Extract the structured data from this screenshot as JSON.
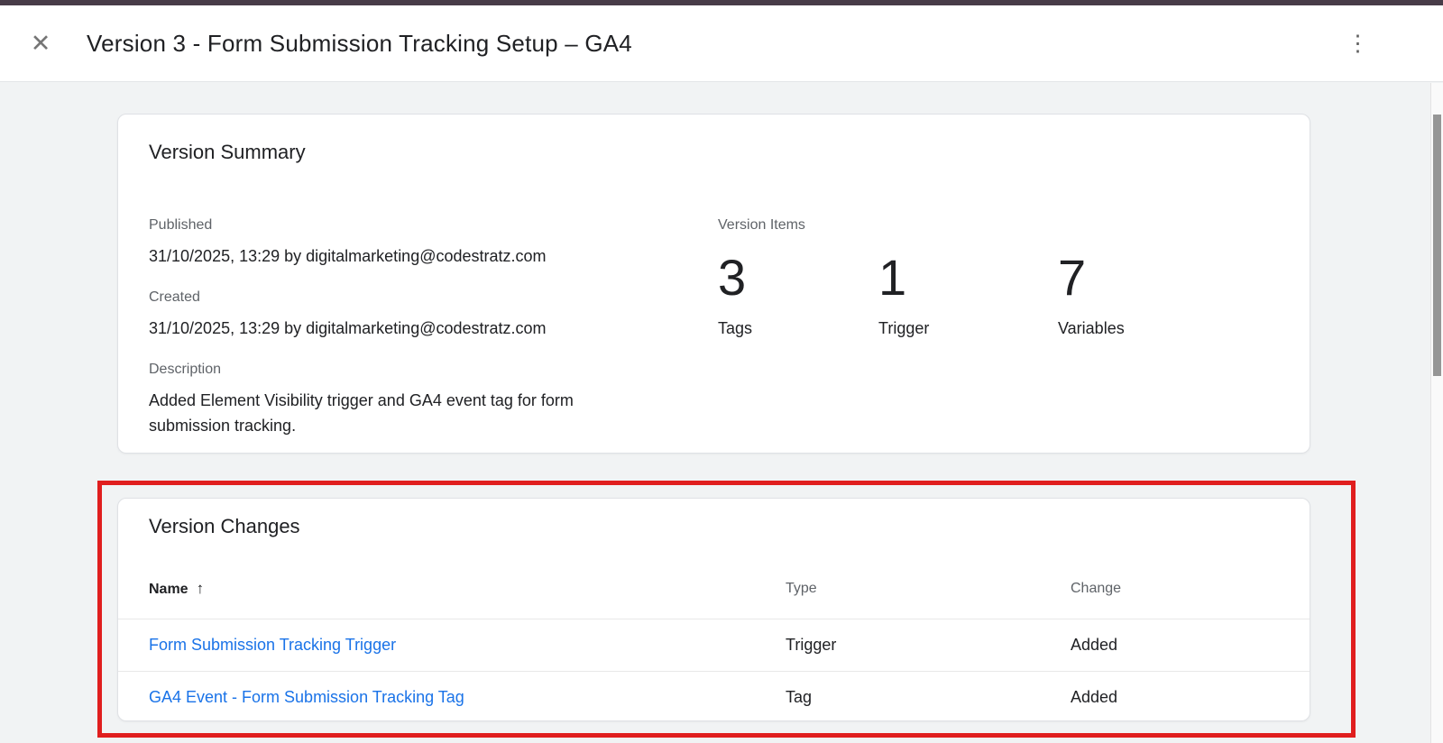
{
  "topbar": {
    "title": "Version 3 - Form Submission Tracking Setup – GA4",
    "close_glyph": "✕",
    "menu_glyph": "⋮"
  },
  "summary_card": {
    "title": "Version Summary",
    "fields": [
      {
        "label": "Published",
        "value": "31/10/2025, 13:29 by digitalmarketing@codestratz.com"
      },
      {
        "label": "Created",
        "value": "31/10/2025, 13:29 by digitalmarketing@codestratz.com"
      },
      {
        "label": "Description",
        "value": "Added Element Visibility trigger and GA4 event tag for form submission tracking."
      }
    ],
    "items": {
      "label": "Version Items",
      "stats": [
        {
          "count": "3",
          "label": "Tags"
        },
        {
          "count": "1",
          "label": "Trigger"
        },
        {
          "count": "7",
          "label": "Variables"
        }
      ]
    }
  },
  "changes_card": {
    "title": "Version Changes",
    "columns": {
      "name": "Name",
      "type": "Type",
      "change": "Change"
    },
    "sort_glyph": "↑",
    "rows": [
      {
        "name": "Form Submission Tracking Trigger",
        "type": "Trigger",
        "change": "Added"
      },
      {
        "name": "GA4 Event - Form Submission Tracking Tag",
        "type": "Tag",
        "change": "Added"
      }
    ]
  },
  "colors": {
    "annotation_red": "#e01e1e",
    "link_blue": "#1a73e8",
    "label_grey": "#5f6368",
    "text_dark": "#202124",
    "page_background": "#f1f3f4",
    "topstrip": "#483c48"
  }
}
